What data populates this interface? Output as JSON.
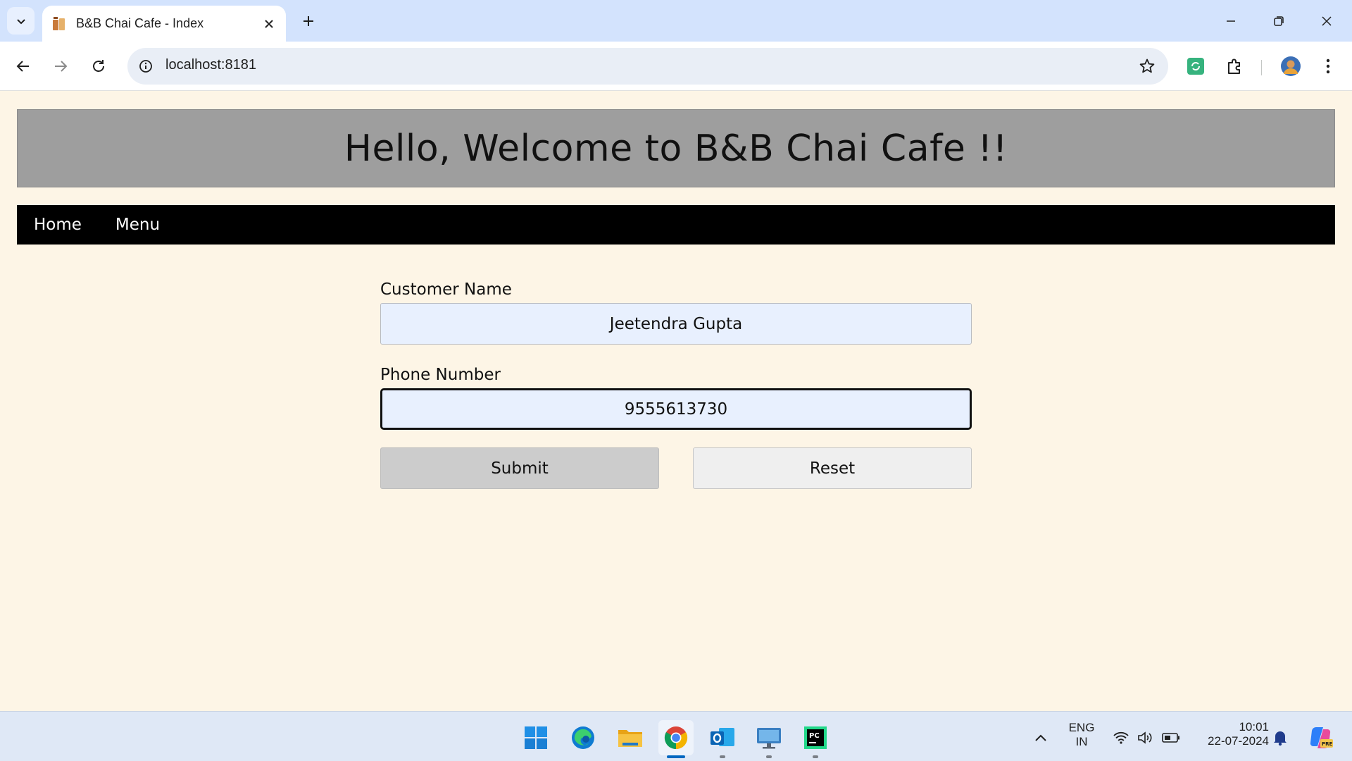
{
  "browser": {
    "tab_title": "B&B Chai Cafe - Index",
    "url": "localhost:8181",
    "icons": [
      "tab-search-icon",
      "cafe-favicon-icon",
      "close-icon",
      "plus-icon",
      "minimize-icon",
      "restore-icon",
      "close-window-icon",
      "back-arrow-icon",
      "forward-arrow-icon",
      "reload-icon",
      "info-icon",
      "star-icon",
      "extension-sync-icon",
      "puzzle-icon",
      "profile-avatar-icon",
      "more-vert-icon"
    ]
  },
  "page": {
    "banner_title": "Hello, Welcome to B&B Chai Cafe !!",
    "nav": [
      {
        "label": "Home"
      },
      {
        "label": "Menu"
      }
    ],
    "form": {
      "customer_name_label": "Customer Name",
      "customer_name_value": "Jeetendra Gupta",
      "phone_label": "Phone Number",
      "phone_value": "9555613730",
      "submit_label": "Submit",
      "reset_label": "Reset"
    }
  },
  "taskbar": {
    "apps": [
      "windows-start-icon",
      "edge-icon",
      "file-explorer-icon",
      "chrome-icon",
      "outlook-icon",
      "remote-desktop-icon",
      "pycharm-icon"
    ],
    "lang_line1": "ENG",
    "lang_line2": "IN",
    "time": "10:01",
    "date": "22-07-2024"
  },
  "colors": {
    "page_bg": "#fdf5e6",
    "banner_bg": "#9e9e9e",
    "nav_bg": "#000000",
    "input_bg": "#e8f0fe",
    "chrome_tabstrip": "#d3e3fd"
  }
}
